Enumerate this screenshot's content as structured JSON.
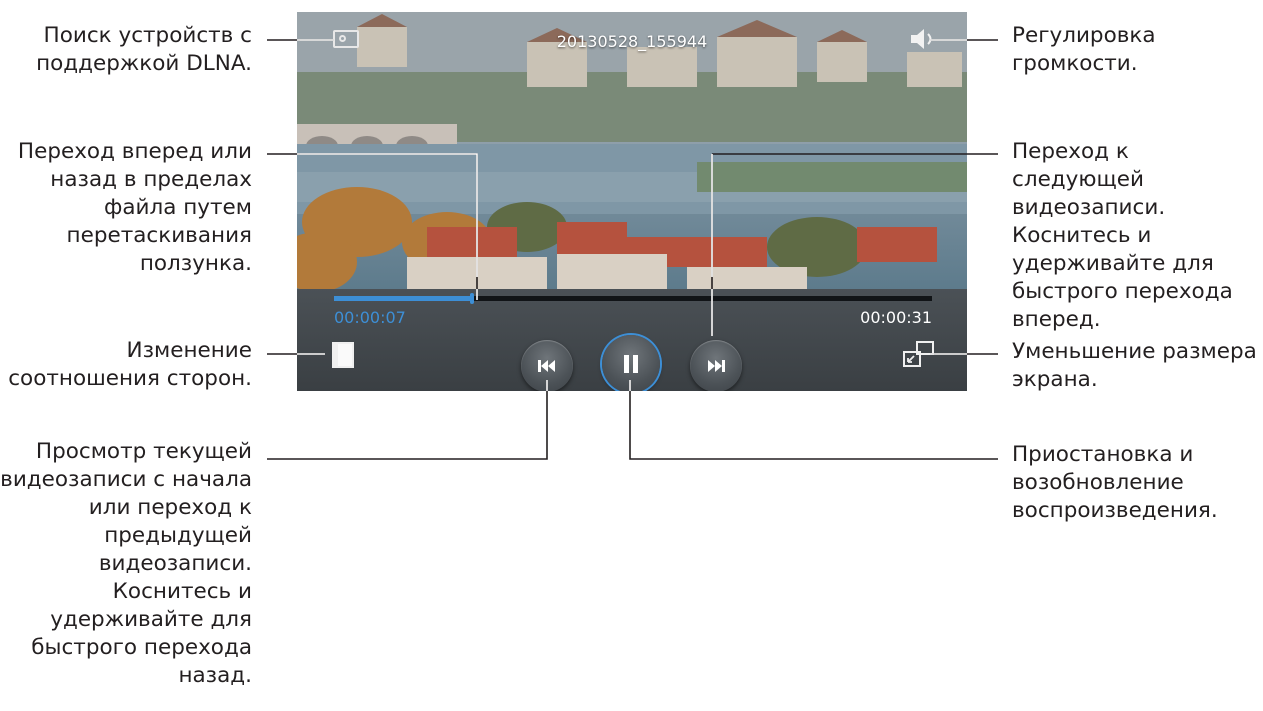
{
  "player": {
    "video_title": "20130528_155944",
    "elapsed_time": "00:00:07",
    "total_time": "00:00:31",
    "progress_fraction": 0.23,
    "accent_color": "#3d8fd6"
  },
  "callouts": {
    "dlna_search": "Поиск устройств с\nподдержкой DLNA.",
    "seek": "Переход вперед или\nназад в пределах\nфайла путем\nперетаскивания\nползунка.",
    "aspect_ratio": "Изменение\nсоотношения сторон.",
    "previous": "Просмотр текущей\nвидеозаписи с начала\nили переход к\nпредыдущей\nвидеозаписи.\nКоснитесь и\nудерживайте для\nбыстрого перехода\nназад.",
    "volume": "Регулировка\nгромкости.",
    "next": "Переход к следующей\nвидеозаписи.\nКоснитесь и\nудерживайте для\nбыстрого перехода\nвперед.",
    "minimize": "Уменьшение размера\nэкрана.",
    "pause": "Приостановка и\nвозобновление\nвоспроизведения."
  },
  "icons": {
    "dlna": "dlna-icon",
    "volume": "volume-icon",
    "aspect": "aspect-ratio-icon",
    "prev": "previous-icon",
    "pause": "pause-icon",
    "next": "next-icon",
    "popup": "popup-player-icon"
  }
}
